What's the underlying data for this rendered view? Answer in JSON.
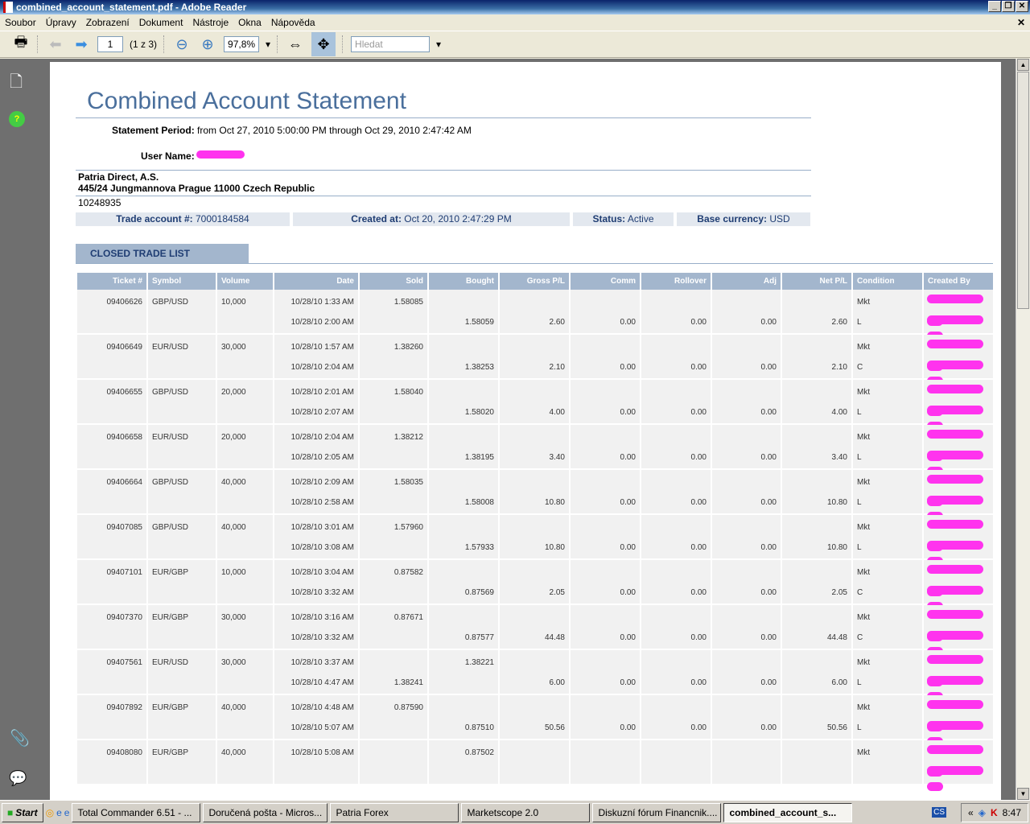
{
  "window": {
    "title": "combined_account_statement.pdf - Adobe Reader"
  },
  "menu": [
    "Soubor",
    "Úpravy",
    "Zobrazení",
    "Dokument",
    "Nástroje",
    "Okna",
    "Nápověda"
  ],
  "toolbar": {
    "page": "1",
    "page_count": "(1 z 3)",
    "zoom": "97,8%",
    "search_placeholder": "Hledat"
  },
  "doc": {
    "title": "Combined Account Statement",
    "period_label": "Statement Period:",
    "period_value": "from Oct 27, 2010 5:00:00 PM through Oct 29, 2010 2:47:42 AM",
    "user_label": "User Name:",
    "broker": "Patria Direct, A.S.",
    "address": "445/24 Jungmannova Prague 11000 Czech Republic",
    "account_id": "10248935",
    "trade_account_label": "Trade account #:",
    "trade_account": "7000184584",
    "created_label": "Created at:",
    "created": "Oct 20, 2010 2:47:29 PM",
    "status_label": "Status:",
    "status": "Active",
    "currency_label": "Base currency:",
    "currency": "USD",
    "section": "CLOSED TRADE LIST"
  },
  "table": {
    "headers": [
      "Ticket #",
      "Symbol",
      "Volume",
      "Date",
      "Sold",
      "Bought",
      "Gross P/L",
      "Comm",
      "Rollover",
      "Adj",
      "Net P/L",
      "Condition",
      "Created By"
    ],
    "rows": [
      {
        "ticket": "09406626",
        "symbol": "GBP/USD",
        "volume": "10,000",
        "open_date": "10/28/10 1:33 AM",
        "close_date": "10/28/10 2:00 AM",
        "open_sold": "1.58085",
        "open_bought": "",
        "close_sold": "",
        "close_bought": "1.58059",
        "gross": "2.60",
        "comm": "0.00",
        "rollover": "0.00",
        "adj": "0.00",
        "net": "2.60",
        "cond1": "Mkt",
        "cond2": "L"
      },
      {
        "ticket": "09406649",
        "symbol": "EUR/USD",
        "volume": "30,000",
        "open_date": "10/28/10 1:57 AM",
        "close_date": "10/28/10 2:04 AM",
        "open_sold": "1.38260",
        "open_bought": "",
        "close_sold": "",
        "close_bought": "1.38253",
        "gross": "2.10",
        "comm": "0.00",
        "rollover": "0.00",
        "adj": "0.00",
        "net": "2.10",
        "cond1": "Mkt",
        "cond2": "C"
      },
      {
        "ticket": "09406655",
        "symbol": "GBP/USD",
        "volume": "20,000",
        "open_date": "10/28/10 2:01 AM",
        "close_date": "10/28/10 2:07 AM",
        "open_sold": "1.58040",
        "open_bought": "",
        "close_sold": "",
        "close_bought": "1.58020",
        "gross": "4.00",
        "comm": "0.00",
        "rollover": "0.00",
        "adj": "0.00",
        "net": "4.00",
        "cond1": "Mkt",
        "cond2": "L"
      },
      {
        "ticket": "09406658",
        "symbol": "EUR/USD",
        "volume": "20,000",
        "open_date": "10/28/10 2:04 AM",
        "close_date": "10/28/10 2:05 AM",
        "open_sold": "1.38212",
        "open_bought": "",
        "close_sold": "",
        "close_bought": "1.38195",
        "gross": "3.40",
        "comm": "0.00",
        "rollover": "0.00",
        "adj": "0.00",
        "net": "3.40",
        "cond1": "Mkt",
        "cond2": "L"
      },
      {
        "ticket": "09406664",
        "symbol": "GBP/USD",
        "volume": "40,000",
        "open_date": "10/28/10 2:09 AM",
        "close_date": "10/28/10 2:58 AM",
        "open_sold": "1.58035",
        "open_bought": "",
        "close_sold": "",
        "close_bought": "1.58008",
        "gross": "10.80",
        "comm": "0.00",
        "rollover": "0.00",
        "adj": "0.00",
        "net": "10.80",
        "cond1": "Mkt",
        "cond2": "L"
      },
      {
        "ticket": "09407085",
        "symbol": "GBP/USD",
        "volume": "40,000",
        "open_date": "10/28/10 3:01 AM",
        "close_date": "10/28/10 3:08 AM",
        "open_sold": "1.57960",
        "open_bought": "",
        "close_sold": "",
        "close_bought": "1.57933",
        "gross": "10.80",
        "comm": "0.00",
        "rollover": "0.00",
        "adj": "0.00",
        "net": "10.80",
        "cond1": "Mkt",
        "cond2": "L"
      },
      {
        "ticket": "09407101",
        "symbol": "EUR/GBP",
        "volume": "10,000",
        "open_date": "10/28/10 3:04 AM",
        "close_date": "10/28/10 3:32 AM",
        "open_sold": "0.87582",
        "open_bought": "",
        "close_sold": "",
        "close_bought": "0.87569",
        "gross": "2.05",
        "comm": "0.00",
        "rollover": "0.00",
        "adj": "0.00",
        "net": "2.05",
        "cond1": "Mkt",
        "cond2": "C"
      },
      {
        "ticket": "09407370",
        "symbol": "EUR/GBP",
        "volume": "30,000",
        "open_date": "10/28/10 3:16 AM",
        "close_date": "10/28/10 3:32 AM",
        "open_sold": "0.87671",
        "open_bought": "",
        "close_sold": "",
        "close_bought": "0.87577",
        "gross": "44.48",
        "comm": "0.00",
        "rollover": "0.00",
        "adj": "0.00",
        "net": "44.48",
        "cond1": "Mkt",
        "cond2": "C"
      },
      {
        "ticket": "09407561",
        "symbol": "EUR/USD",
        "volume": "30,000",
        "open_date": "10/28/10 3:37 AM",
        "close_date": "10/28/10 4:47 AM",
        "open_sold": "",
        "open_bought": "1.38221",
        "close_sold": "1.38241",
        "close_bought": "",
        "gross": "6.00",
        "comm": "0.00",
        "rollover": "0.00",
        "adj": "0.00",
        "net": "6.00",
        "cond1": "Mkt",
        "cond2": "L"
      },
      {
        "ticket": "09407892",
        "symbol": "EUR/GBP",
        "volume": "40,000",
        "open_date": "10/28/10 4:48 AM",
        "close_date": "10/28/10 5:07 AM",
        "open_sold": "0.87590",
        "open_bought": "",
        "close_sold": "",
        "close_bought": "0.87510",
        "gross": "50.56",
        "comm": "0.00",
        "rollover": "0.00",
        "adj": "0.00",
        "net": "50.56",
        "cond1": "Mkt",
        "cond2": "L"
      },
      {
        "ticket": "09408080",
        "symbol": "EUR/GBP",
        "volume": "40,000",
        "open_date": "10/28/10 5:08 AM",
        "close_date": "",
        "open_sold": "",
        "open_bought": "0.87502",
        "close_sold": "",
        "close_bought": "",
        "gross": "",
        "comm": "",
        "rollover": "",
        "adj": "",
        "net": "",
        "cond1": "Mkt",
        "cond2": ""
      }
    ]
  },
  "taskbar": {
    "start": "Start",
    "tasks": [
      "Total Commander 6.51 - ...",
      "Doručená pošta - Micros...",
      "Patria Forex",
      "Marketscope 2.0",
      "Diskuzní fórum Financnik....",
      "combined_account_s..."
    ],
    "lang": "CS",
    "clock": "8:47"
  },
  "colors": {
    "accent": "#a3b6cd",
    "title": "#4a6f9c",
    "redaction": "#ff33ee"
  }
}
